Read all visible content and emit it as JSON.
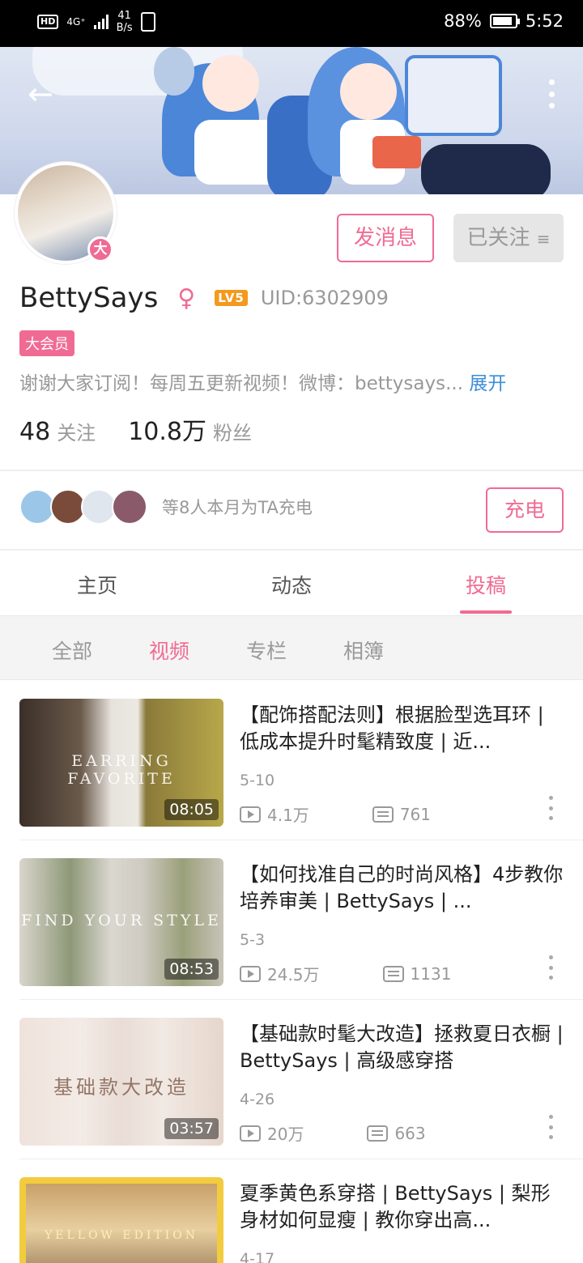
{
  "status_bar": {
    "hd": "HD",
    "net_type": "4G⁺",
    "net_speed_value": "41",
    "net_speed_unit": "B/s",
    "battery_level": 0.88,
    "battery_percent": "88%",
    "time": "5:52"
  },
  "profile": {
    "username": "BettySays",
    "level_badge": "LV5",
    "uid": "UID:6302909",
    "vip_tag": "大会员",
    "avatar_badge": "大",
    "bio": "谢谢大家订阅！每周五更新视频！微博：bettysays...",
    "bio_expand": "展开",
    "following_count": "48",
    "following_label": "关注",
    "fans_count": "10.8万",
    "fans_label": "粉丝"
  },
  "actions": {
    "message": "发消息",
    "followed": "已关注"
  },
  "charge": {
    "text": "等8人本月为TA充电",
    "button": "充电"
  },
  "tabs": [
    {
      "label": "主页"
    },
    {
      "label": "动态"
    },
    {
      "label": "投稿"
    }
  ],
  "subtabs": [
    {
      "label": "全部"
    },
    {
      "label": "视频"
    },
    {
      "label": "专栏"
    },
    {
      "label": "相簿"
    }
  ],
  "videos": [
    {
      "title": "【配饰搭配法则】根据脸型选耳环 | 低成本提升时髦精致度 | 近...",
      "thumb_text": "EARRING FAVORITE",
      "duration": "08:05",
      "date": "5-10",
      "views": "4.1万",
      "danmaku": "761"
    },
    {
      "title": "【如何找准自己的时尚风格】4步教你培养审美 | BettySays | ...",
      "thumb_text": "FIND YOUR STYLE",
      "duration": "08:53",
      "date": "5-3",
      "views": "24.5万",
      "danmaku": "1131"
    },
    {
      "title": "【基础款时髦大改造】拯救夏日衣橱 | BettySays | 高级感穿搭",
      "thumb_text": "基础款大改造",
      "duration": "03:57",
      "date": "4-26",
      "views": "20万",
      "danmaku": "663"
    },
    {
      "title": "夏季黄色系穿搭 | BettySays | 梨形身材如何显瘦 | 教你穿出高...",
      "thumb_text": "YELLOW EDITION",
      "duration": "",
      "date": "4-17",
      "views": "",
      "danmaku": ""
    }
  ]
}
